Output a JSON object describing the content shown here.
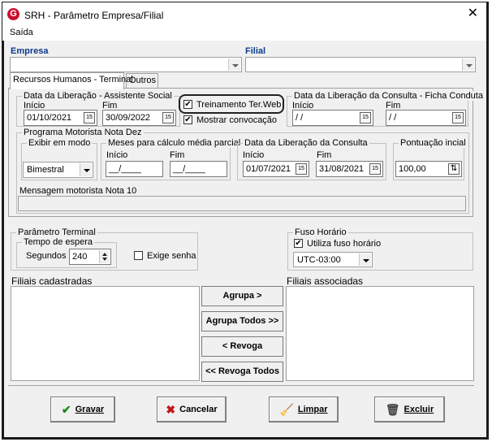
{
  "window": {
    "title": "SRH - Parâmetro Empresa/Filial",
    "app_icon_letter": "G"
  },
  "menu": {
    "saida": "Saída"
  },
  "empresa": {
    "label": "Empresa",
    "value": ""
  },
  "filial": {
    "label": "Filial",
    "value": ""
  },
  "tabs": [
    {
      "label": "Recursos Humanos - Terminal"
    },
    {
      "label": "Outros"
    }
  ],
  "assistente_social": {
    "title": "Data da Liberação - Assistente Social",
    "inicio_label": "Início",
    "fim_label": "Fim",
    "inicio": "01/10/2021",
    "fim": "30/09/2022"
  },
  "checks": {
    "treinamento": {
      "label": "Treinamento Ter.Web",
      "checked": true
    },
    "mostrar": {
      "label": "Mostrar convocação",
      "checked": true
    }
  },
  "ficha_conduta": {
    "title": "Data da Liberação da Consulta  - Ficha Conduta",
    "inicio_label": "Início",
    "fim_label": "Fim",
    "inicio": " / /",
    "fim": " / /"
  },
  "programa": {
    "title": "Programa Motorista Nota Dez",
    "exibir": {
      "title": "Exibir em modo",
      "value": "Bimestral"
    },
    "meses": {
      "title": "Meses para cálculo média parcial",
      "inicio_label": "Início",
      "fim_label": "Fim",
      "inicio": "__/____",
      "fim": "__/____"
    },
    "consulta": {
      "title": "Data da Liberação da Consulta",
      "inicio_label": "Início",
      "fim_label": "Fim",
      "inicio": "01/07/2021",
      "fim": "31/08/2021"
    },
    "pontuacao": {
      "title": "Pontuação incial",
      "value": "100,00"
    },
    "mensagem_label": "Mensagem motorista Nota 10",
    "mensagem": ""
  },
  "terminal": {
    "title": "Parâmetro Terminal",
    "tempo_title": "Tempo de espera",
    "segundos_label": "Segundos",
    "segundos": "240",
    "exige_senha": {
      "label": "Exige senha",
      "checked": false
    }
  },
  "fuso": {
    "title": "Fuso Horário",
    "utiliza": {
      "label": "Utiliza fuso horário",
      "checked": true
    },
    "value": "UTC-03:00"
  },
  "filiais_cadastradas": {
    "label": "Filiais cadastradas",
    "items": []
  },
  "filiais_associadas": {
    "label": "Filiais associadas",
    "items": []
  },
  "mid_buttons": {
    "agrupa": "Agrupa >",
    "agrupa_todos": "Agrupa Todos >>",
    "revoga": "< Revoga",
    "revoga_todos": "<< Revoga Todos"
  },
  "footer_buttons": {
    "gravar": "Gravar",
    "cancelar": "Cancelar",
    "limpar": "Limpar",
    "excluir": "Excluir"
  },
  "colors": {
    "label_blue": "#0a3a8c",
    "icon_red": "#c8102e",
    "check_green": "#1c8a1c",
    "cross_red": "#c01818"
  }
}
